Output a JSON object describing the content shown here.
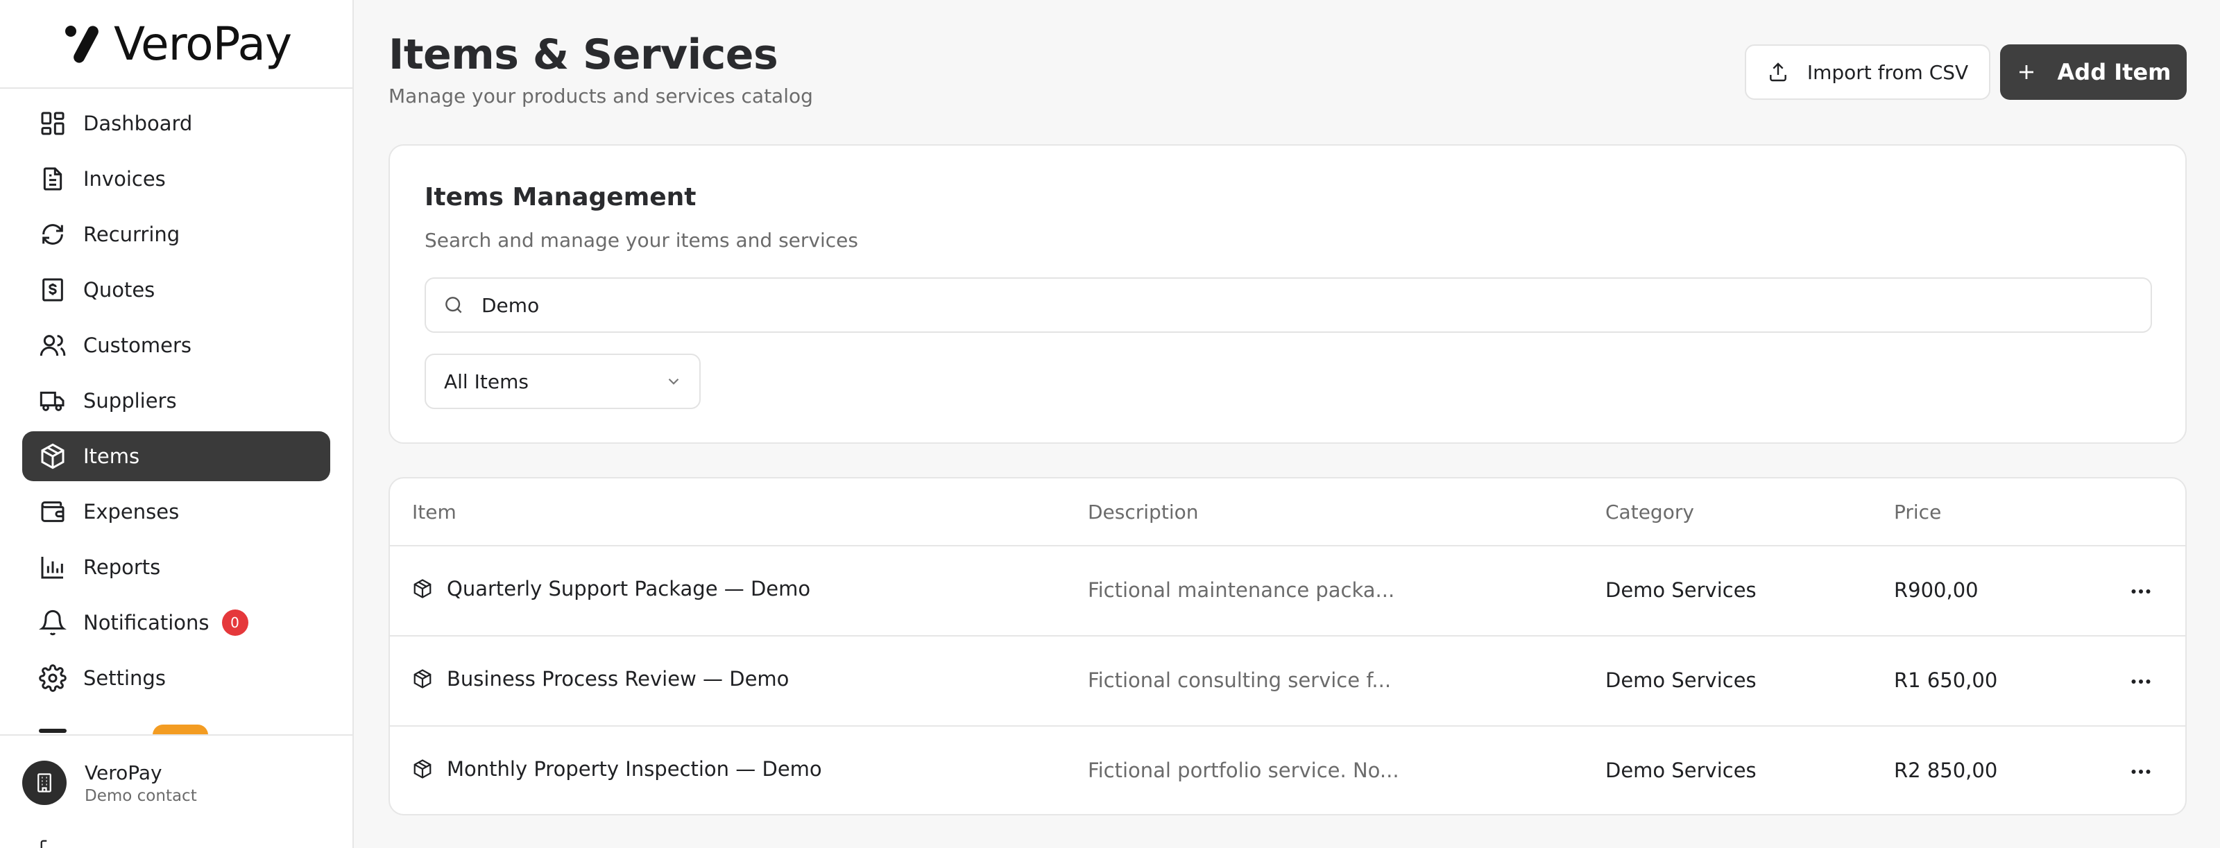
{
  "brand": {
    "name": "VeroPay"
  },
  "sidebar": {
    "items": [
      {
        "label": "Dashboard",
        "icon": "dashboard-icon"
      },
      {
        "label": "Invoices",
        "icon": "file-icon"
      },
      {
        "label": "Recurring",
        "icon": "refresh-icon"
      },
      {
        "label": "Quotes",
        "icon": "dollar-document-icon"
      },
      {
        "label": "Customers",
        "icon": "users-icon"
      },
      {
        "label": "Suppliers",
        "icon": "truck-icon"
      },
      {
        "label": "Items",
        "icon": "package-icon",
        "active": true
      },
      {
        "label": "Expenses",
        "icon": "wallet-icon"
      },
      {
        "label": "Reports",
        "icon": "bar-chart-icon"
      },
      {
        "label": "Notifications",
        "icon": "bell-icon",
        "badge": "0"
      },
      {
        "label": "Settings",
        "icon": "gear-icon"
      }
    ],
    "profile": {
      "name": "VeroPay",
      "subtitle": "Demo contact"
    }
  },
  "header": {
    "title": "Items & Services",
    "subtitle": "Manage your products and services catalog",
    "import_label": "Import from CSV",
    "add_label": "Add Item"
  },
  "management": {
    "title": "Items Management",
    "subtitle": "Search and manage your items and services",
    "search_value": "Demo",
    "filter_value": "All Items"
  },
  "table": {
    "columns": [
      "Item",
      "Description",
      "Category",
      "Price"
    ],
    "rows": [
      {
        "item": "Quarterly Support Package — Demo",
        "description": "Fictional maintenance packa...",
        "category": "Demo Services",
        "price": "R900,00"
      },
      {
        "item": "Business Process Review — Demo",
        "description": "Fictional consulting service f...",
        "category": "Demo Services",
        "price": "R1 650,00"
      },
      {
        "item": "Monthly Property Inspection — Demo",
        "description": "Fictional portfolio service. No...",
        "category": "Demo Services",
        "price": "R2 850,00"
      }
    ]
  },
  "colors": {
    "active_bg": "#3a3a3a",
    "primary_button": "#3f3f3f",
    "badge_red": "#e5383b",
    "badge_orange": "#f39c22"
  }
}
